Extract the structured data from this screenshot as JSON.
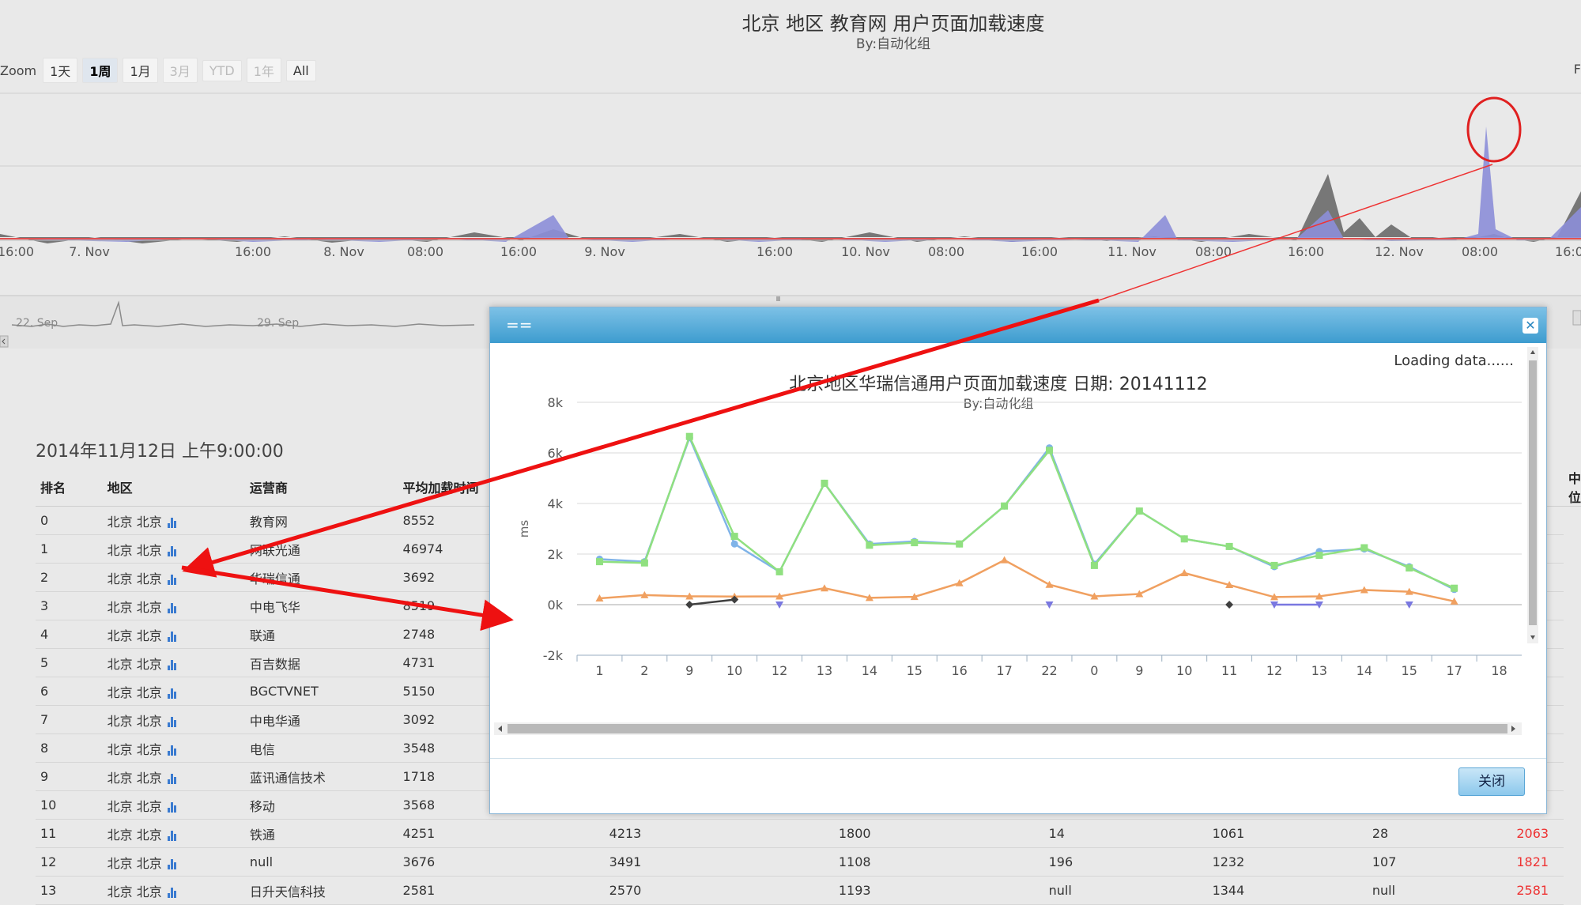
{
  "top": {
    "title": "北京 地区 教育网 用户页面加载速度",
    "subtitle": "By:自动化组",
    "zoom_label": "Zoom",
    "zoom_buttons": [
      "1天",
      "1周",
      "1月",
      "3月",
      "YTD",
      "1年",
      "All"
    ],
    "edge_mark": "F",
    "x_labels": [
      "16:00",
      "7. Nov",
      "16:00",
      "8. Nov",
      "08:00",
      "16:00",
      "9. Nov",
      "16:00",
      "10. Nov",
      "08:00",
      "16:00",
      "11. Nov",
      "08:00",
      "16:00",
      "12. Nov",
      "08:00",
      "16:0"
    ],
    "nav_labels": [
      "22. Sep",
      "29. Sep"
    ]
  },
  "table": {
    "date": "2014年11月12日 上午9:00:00",
    "headers": [
      "排名",
      "地区",
      "运营商",
      "平均加载时间",
      "",
      "",
      "",
      "",
      "",
      "",
      "中位"
    ],
    "rows": [
      [
        "0",
        "北京 北京",
        "教育网",
        "8552",
        "",
        "",
        "",
        "",
        "",
        ""
      ],
      [
        "1",
        "北京 北京",
        "网联光通",
        "46974",
        "",
        "",
        "",
        "",
        "",
        ""
      ],
      [
        "2",
        "北京 北京",
        "华瑞信通",
        "3692",
        "",
        "",
        "",
        "",
        "",
        ""
      ],
      [
        "3",
        "北京 北京",
        "中电飞华",
        "8519",
        "",
        "",
        "",
        "",
        "",
        ""
      ],
      [
        "4",
        "北京 北京",
        "联通",
        "2748",
        "",
        "",
        "",
        "",
        "",
        ""
      ],
      [
        "5",
        "北京 北京",
        "百吉数据",
        "4731",
        "",
        "",
        "",
        "",
        "",
        ""
      ],
      [
        "6",
        "北京 北京",
        "BGCTVNET",
        "5150",
        "",
        "",
        "",
        "",
        "",
        ""
      ],
      [
        "7",
        "北京 北京",
        "中电华通",
        "3092",
        "",
        "",
        "",
        "",
        "",
        ""
      ],
      [
        "8",
        "北京 北京",
        "电信",
        "3548",
        "",
        "",
        "",
        "",
        "",
        ""
      ],
      [
        "9",
        "北京 北京",
        "蓝讯通信技术",
        "1718",
        "",
        "",
        "",
        "",
        "",
        ""
      ],
      [
        "10",
        "北京 北京",
        "移动",
        "3568",
        "",
        "",
        "",
        "",
        "",
        ""
      ],
      [
        "11",
        "北京 北京",
        "铁通",
        "4251",
        "4213",
        "1800",
        "14",
        "1061",
        "28",
        "2063"
      ],
      [
        "12",
        "北京 北京",
        "null",
        "3676",
        "3491",
        "1108",
        "196",
        "1232",
        "107",
        "1821"
      ],
      [
        "13",
        "北京 北京",
        "日升天信科技",
        "2581",
        "2570",
        "1193",
        "null",
        "1344",
        "null",
        "2581"
      ]
    ]
  },
  "modal": {
    "title": "==",
    "close_icon": "close-icon",
    "loading": "Loading data......",
    "ok_label": "关闭",
    "accent": "#3d9ccf"
  },
  "chart_data": {
    "type": "line",
    "title": "北京地区华瑞信通用户页面加载速度 日期: 20141112",
    "subtitle": "By:自动化组",
    "ylabel": "ms",
    "xlabel": "",
    "ylim": [
      -2000,
      8000
    ],
    "yticks": [
      "8k",
      "6k",
      "4k",
      "2k",
      "0k",
      "-2k"
    ],
    "categories": [
      "1",
      "2",
      "9",
      "10",
      "12",
      "13",
      "14",
      "15",
      "16",
      "17",
      "22",
      "0",
      "9",
      "10",
      "11",
      "12",
      "13",
      "14",
      "15",
      "17",
      "18"
    ],
    "series": [
      {
        "color": "#7fb3e8",
        "marker": "circle",
        "values": [
          1800,
          1700,
          6600,
          2400,
          1300,
          4800,
          2400,
          2500,
          2400,
          3900,
          6200,
          1600,
          3700,
          2600,
          2300,
          1500,
          2100,
          2200,
          1500,
          600,
          null
        ]
      },
      {
        "color": "#90e080",
        "marker": "square",
        "values": [
          1700,
          1650,
          6650,
          2700,
          1300,
          4800,
          2350,
          2450,
          2400,
          3900,
          6100,
          1550,
          3700,
          2600,
          2300,
          1550,
          1950,
          2250,
          1450,
          650,
          null
        ]
      },
      {
        "color": "#f0a060",
        "marker": "triangle",
        "values": [
          250,
          380,
          330,
          320,
          330,
          650,
          270,
          310,
          850,
          1760,
          790,
          330,
          420,
          1250,
          780,
          300,
          330,
          580,
          510,
          130,
          null
        ]
      },
      {
        "color": "#3f3f3f",
        "marker": "diamond",
        "values": [
          null,
          null,
          0,
          200,
          null,
          null,
          null,
          null,
          null,
          null,
          null,
          null,
          null,
          null,
          0,
          null,
          null,
          null,
          null,
          null,
          null
        ]
      },
      {
        "color": "#7a78e0",
        "marker": "triangle-down",
        "values": [
          null,
          null,
          null,
          null,
          0,
          null,
          null,
          null,
          null,
          null,
          0,
          null,
          null,
          null,
          null,
          0,
          0,
          null,
          0,
          null,
          null
        ]
      }
    ]
  }
}
